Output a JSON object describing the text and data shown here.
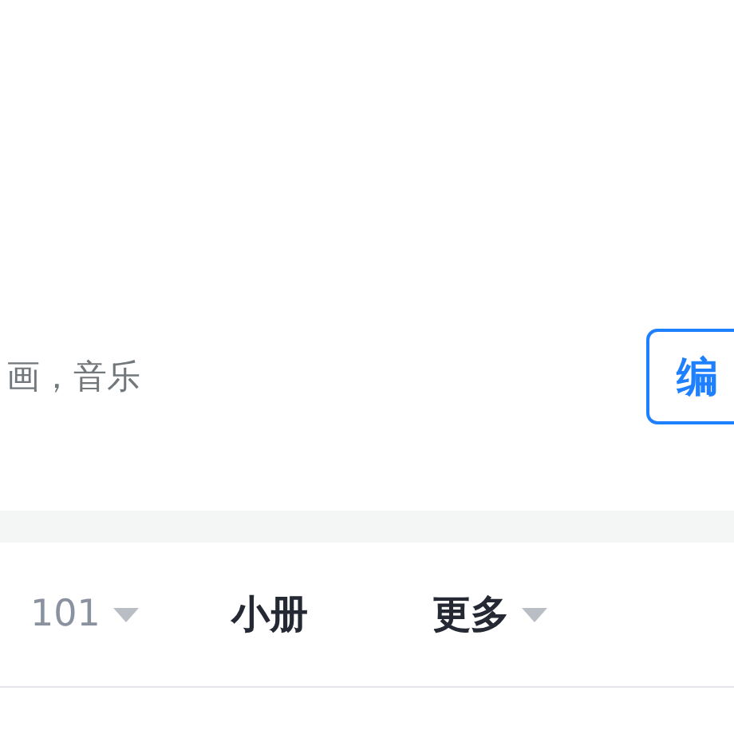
{
  "profile": {
    "interests": "画，音乐",
    "edit_button": "编"
  },
  "tabs": [
    {
      "count": "101",
      "dropdown": true
    },
    {
      "label": "小册",
      "dropdown": false
    },
    {
      "label": "更多",
      "dropdown": true
    }
  ]
}
